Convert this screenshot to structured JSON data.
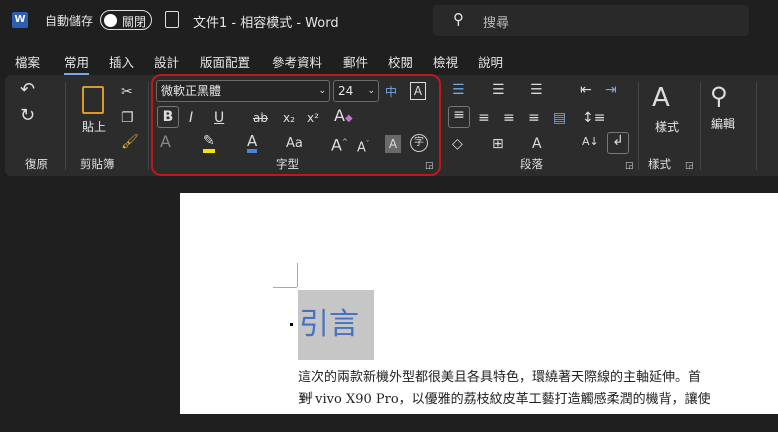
{
  "titlebar": {
    "logo": "W",
    "autosave_label": "自動儲存",
    "autosave_state": "關閉",
    "title": "文件1 - 相容模式 - Word",
    "search_placeholder": "搜尋"
  },
  "tabs": [
    "檔案",
    "常用",
    "插入",
    "設計",
    "版面配置",
    "參考資料",
    "郵件",
    "校閱",
    "檢視",
    "說明"
  ],
  "ribbon": {
    "groups": {
      "undo": "復原",
      "clipboard": "剪貼簿",
      "font": "字型",
      "paragraph": "段落",
      "styles": "樣式"
    },
    "paste_label": "貼上",
    "styles_label": "樣式",
    "edit_label": "編輯",
    "font_name": "微軟正黑體",
    "font_size": "24",
    "bold": "B",
    "italic": "I",
    "underline": "U",
    "strike": "ab",
    "subscript": "x₂",
    "superscript": "x²",
    "case": "Aa"
  },
  "document": {
    "heading": "引言",
    "line1": "這次的兩款新機外型都很美且各具特色，環繞著天際線的主軸延伸。首",
    "line2": "到 vivo X90 Pro，以優雅的荔枝紋皮革工藝打造觸感柔潤的機背，讓使"
  },
  "colors": {
    "highlight": "#f5e400",
    "font_color": "#4a86d8",
    "heading": "#4472c4",
    "selection_box": "#c0171d"
  }
}
